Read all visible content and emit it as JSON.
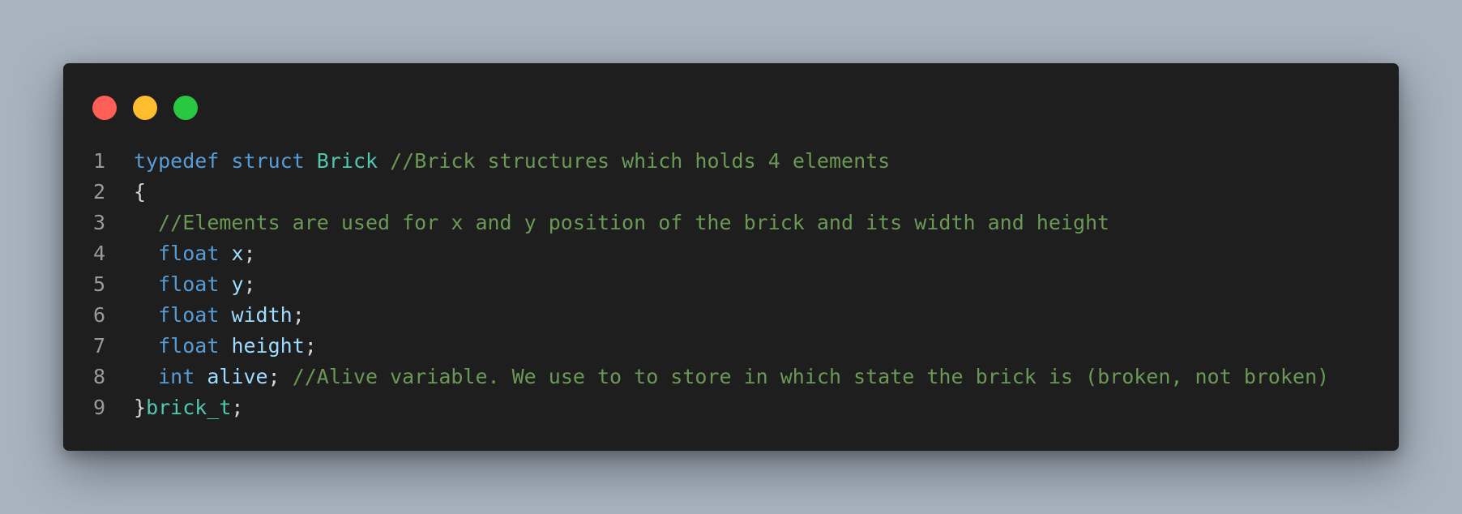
{
  "window": {
    "traffic_lights": {
      "close_color": "#ff5f57",
      "minimize_color": "#febc2e",
      "maximize_color": "#28c840"
    }
  },
  "code": {
    "language": "c",
    "lines": [
      {
        "number": "1",
        "tokens": [
          {
            "text": "typedef",
            "type": "kw"
          },
          {
            "text": " ",
            "type": "pn"
          },
          {
            "text": "struct",
            "type": "kw"
          },
          {
            "text": " ",
            "type": "pn"
          },
          {
            "text": "Brick",
            "type": "ty"
          },
          {
            "text": " ",
            "type": "pn"
          },
          {
            "text": "//Brick structures which holds 4 elements",
            "type": "cm"
          }
        ]
      },
      {
        "number": "2",
        "tokens": [
          {
            "text": "{",
            "type": "pn"
          }
        ]
      },
      {
        "number": "3",
        "tokens": [
          {
            "text": "  ",
            "type": "pn"
          },
          {
            "text": "//Elements are used for x and y position of the brick and its width and height",
            "type": "cm"
          }
        ]
      },
      {
        "number": "4",
        "tokens": [
          {
            "text": "  ",
            "type": "pn"
          },
          {
            "text": "float",
            "type": "kw"
          },
          {
            "text": " ",
            "type": "pn"
          },
          {
            "text": "x",
            "type": "id"
          },
          {
            "text": ";",
            "type": "pn"
          }
        ]
      },
      {
        "number": "5",
        "tokens": [
          {
            "text": "  ",
            "type": "pn"
          },
          {
            "text": "float",
            "type": "kw"
          },
          {
            "text": " ",
            "type": "pn"
          },
          {
            "text": "y",
            "type": "id"
          },
          {
            "text": ";",
            "type": "pn"
          }
        ]
      },
      {
        "number": "6",
        "tokens": [
          {
            "text": "  ",
            "type": "pn"
          },
          {
            "text": "float",
            "type": "kw"
          },
          {
            "text": " ",
            "type": "pn"
          },
          {
            "text": "width",
            "type": "id"
          },
          {
            "text": ";",
            "type": "pn"
          }
        ]
      },
      {
        "number": "7",
        "tokens": [
          {
            "text": "  ",
            "type": "pn"
          },
          {
            "text": "float",
            "type": "kw"
          },
          {
            "text": " ",
            "type": "pn"
          },
          {
            "text": "height",
            "type": "id"
          },
          {
            "text": ";",
            "type": "pn"
          }
        ]
      },
      {
        "number": "8",
        "tokens": [
          {
            "text": "  ",
            "type": "pn"
          },
          {
            "text": "int",
            "type": "kw"
          },
          {
            "text": " ",
            "type": "pn"
          },
          {
            "text": "alive",
            "type": "id"
          },
          {
            "text": "; ",
            "type": "pn"
          },
          {
            "text": "//Alive variable. We use to to store in which state the brick is (broken, not broken)",
            "type": "cm"
          }
        ]
      },
      {
        "number": "9",
        "tokens": [
          {
            "text": "}",
            "type": "pn"
          },
          {
            "text": "brick_t",
            "type": "ty"
          },
          {
            "text": ";",
            "type": "pn"
          }
        ]
      }
    ]
  }
}
